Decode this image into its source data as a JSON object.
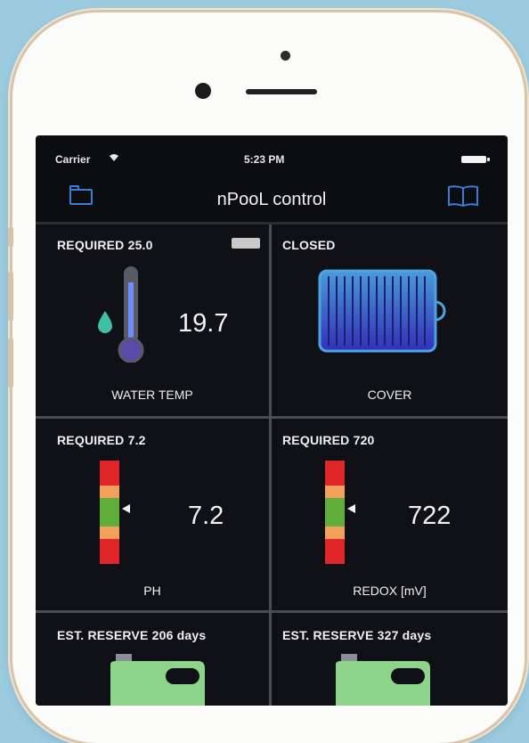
{
  "status_bar": {
    "carrier": "Carrier",
    "time": "5:23 PM"
  },
  "nav": {
    "title": "nPooL control",
    "left_icon": "folder-icon",
    "right_icon": "book-icon"
  },
  "tiles": {
    "water_temp": {
      "header": "REQUIRED 25.0",
      "value": "19.7",
      "caption": "WATER TEMP",
      "toggle_on": false
    },
    "cover": {
      "header": "CLOSED",
      "caption": "COVER"
    },
    "ph": {
      "header": "REQUIRED 7.2",
      "value": "7.2",
      "caption": "PH"
    },
    "redox": {
      "header": "REQUIRED 720",
      "value": "722",
      "caption": "REDOX [mV]"
    },
    "reserve_left": {
      "header": "EST. RESERVE 206 days"
    },
    "reserve_right": {
      "header": "EST. RESERVE 327 days"
    }
  },
  "colors": {
    "accent": "#3a7ed9",
    "meter_red": "#e0262a",
    "meter_orange": "#f2a05a",
    "meter_green": "#5fae3a",
    "canister_green": "#8ed48a",
    "cover_blue": "#3f4fd0"
  }
}
